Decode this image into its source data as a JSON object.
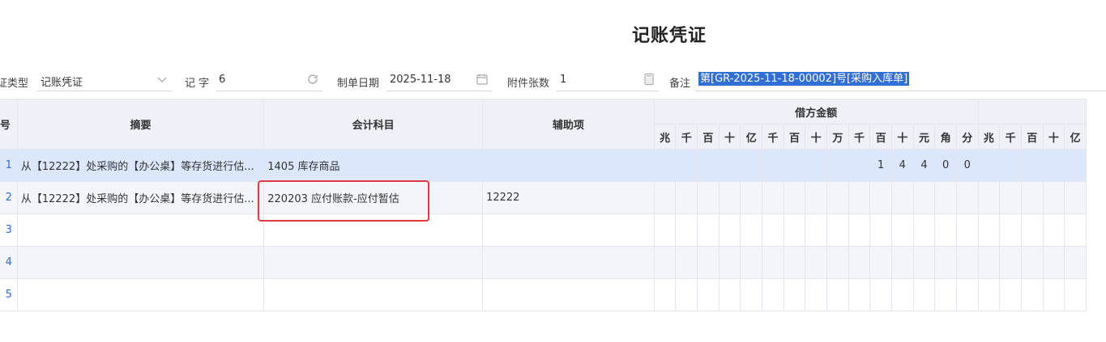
{
  "title": "记账凭证",
  "header": {
    "type_label": "证类型",
    "type_value": "记账凭证",
    "word_label": "记 字",
    "word_value": "6",
    "date_label": "制单日期",
    "date_value": "2025-11-18",
    "attach_label": "附件张数",
    "attach_value": "1",
    "remark_label": "备注",
    "remark_value": "第[GR-2025-11-18-00002]号[采购入库单]"
  },
  "table": {
    "col_no": "号",
    "col_summary": "摘要",
    "col_account": "会计科目",
    "col_aux": "辅助项",
    "col_debit": "借方金额",
    "digits": [
      "兆",
      "千",
      "百",
      "十",
      "亿",
      "千",
      "百",
      "十",
      "万",
      "千",
      "百",
      "十",
      "元",
      "角",
      "分"
    ],
    "credit_digits": [
      "兆",
      "千",
      "百",
      "十",
      "亿"
    ],
    "rows": [
      {
        "no": "1",
        "summary": "从【12222】处采购的【办公桌】等存货进行估...",
        "account": "1405 库存商品",
        "aux": "",
        "amount": [
          "",
          "",
          "",
          "",
          "",
          "",
          "",
          "",
          "",
          "",
          "1",
          "4",
          "4",
          "0",
          "0"
        ]
      },
      {
        "no": "2",
        "summary": "从【12222】处采购的【办公桌】等存货进行估...",
        "account": "220203 应付账款-应付暂估",
        "aux": "12222",
        "amount": [
          "",
          "",
          "",
          "",
          "",
          "",
          "",
          "",
          "",
          "",
          "",
          "",
          "",
          "",
          ""
        ]
      },
      {
        "no": "3",
        "summary": "",
        "account": "",
        "aux": "",
        "amount": [
          "",
          "",
          "",
          "",
          "",
          "",
          "",
          "",
          "",
          "",
          "",
          "",
          "",
          "",
          ""
        ]
      },
      {
        "no": "4",
        "summary": "",
        "account": "",
        "aux": "",
        "amount": [
          "",
          "",
          "",
          "",
          "",
          "",
          "",
          "",
          "",
          "",
          "",
          "",
          "",
          "",
          ""
        ]
      },
      {
        "no": "5",
        "summary": "",
        "account": "",
        "aux": "",
        "amount": [
          "",
          "",
          "",
          "",
          "",
          "",
          "",
          "",
          "",
          "",
          "",
          "",
          "",
          "",
          ""
        ]
      }
    ]
  },
  "icons": {
    "type": "chevron-down-icon",
    "word": "refresh-icon",
    "date": "calendar-icon",
    "attach": "calculator-icon"
  }
}
